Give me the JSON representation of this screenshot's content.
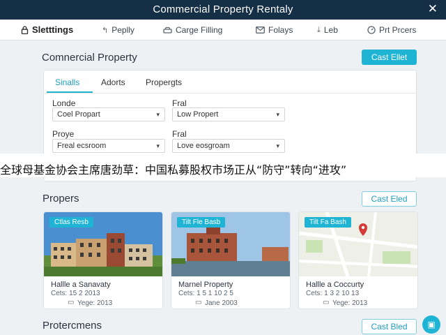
{
  "window": {
    "title": "Commercial Property Rentaly"
  },
  "nav": [
    {
      "icon": "lock",
      "label": "Sletttings",
      "active": true
    },
    {
      "icon": "reply",
      "label": "Peplly"
    },
    {
      "icon": "car",
      "label": "Carge Filling"
    },
    {
      "icon": "mail",
      "label": "Folays"
    },
    {
      "icon": "download",
      "label": "Leb"
    },
    {
      "icon": "gauge",
      "label": "Prt Prcers"
    }
  ],
  "main": {
    "heading": "Comnercial Property",
    "action_label": "Cast Ellet"
  },
  "filter": {
    "tabs": [
      "Sinalls",
      "Adorts",
      "Propergts"
    ],
    "fields": [
      {
        "label": "Londe",
        "value": "Coel Propart"
      },
      {
        "label": "Fral",
        "value": "Low Propert"
      },
      {
        "label": "Proye",
        "value": "Freal ecsroom"
      },
      {
        "label": "Fral",
        "value": "Love eosgroam"
      }
    ]
  },
  "banner": {
    "text": "全球母基金协会主席唐劲草：中国私募股权市场正从“防守”转向“进攻”"
  },
  "properties": {
    "heading": "Propers",
    "action_label": "Cast Eled",
    "cards": [
      {
        "tag": "Ctlas Resb",
        "name": "Hallle a Sanavaty",
        "sub": "Cets: 15 2 2013",
        "year": "Yege: 2013"
      },
      {
        "tag": "Tilt Fle Basb",
        "name": "Marnel Property",
        "sub": "Cets: 1 5 1 10 2 5",
        "year": "Jane 2003"
      },
      {
        "tag": "Tilt Fa Bash",
        "name": "Hallle a Coccurty",
        "sub": "Cets: 1 3 2 10 13",
        "year": "Yege: 2013"
      }
    ]
  },
  "section3": {
    "heading": "Protercmens",
    "action_label": "Cast Bled"
  },
  "colors": {
    "accent": "#1fb4d4",
    "titlebar": "#152f47"
  }
}
